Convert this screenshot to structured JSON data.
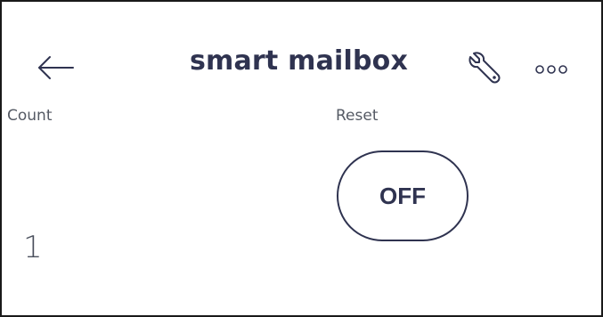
{
  "header": {
    "back_icon": "arrow-left-icon",
    "title": "smart mailbox",
    "settings_icon": "wrench-icon",
    "more_icon": "more-horizontal-icon"
  },
  "main": {
    "count_label": "Count",
    "count_value": "1",
    "reset_label": "Reset",
    "reset_state": "OFF"
  },
  "colors": {
    "accent": "#2f3350",
    "label": "#555a64",
    "background": "#ffffff"
  }
}
